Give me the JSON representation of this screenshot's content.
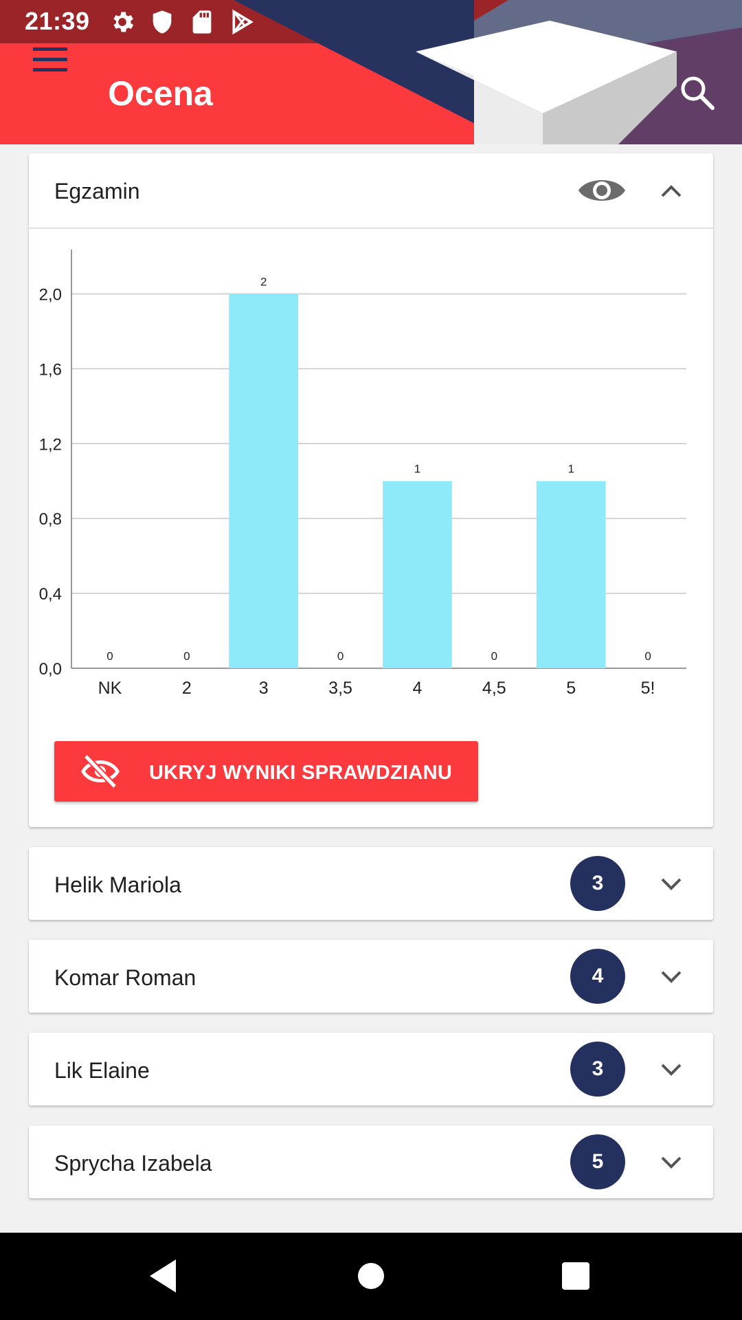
{
  "status_bar": {
    "time": "21:39",
    "left_icons": [
      "gear-icon",
      "shield-icon",
      "sd-card-icon",
      "play-store-icon"
    ],
    "right_icons": [
      "wifi-icon",
      "signal-icon",
      "battery-icon"
    ]
  },
  "app_bar": {
    "title": "Ocena",
    "menu_icon": "menu-icon",
    "search_icon": "search-icon",
    "color": "#fc3a3e"
  },
  "exam_card": {
    "title": "Egzamin",
    "visibility_icon": "eye-icon",
    "collapse_icon": "chevron-up-icon",
    "hide_button_label": "UKRYJ WYNIKI SPRAWDZIANU",
    "hide_button_icon": "eye-off-icon"
  },
  "chart_data": {
    "type": "bar",
    "categories": [
      "NK",
      "2",
      "3",
      "3,5",
      "4",
      "4,5",
      "5",
      "5!"
    ],
    "values": [
      0,
      0,
      2,
      0,
      1,
      0,
      1,
      0
    ],
    "value_labels": [
      "0",
      "0",
      "2",
      "0",
      "1",
      "0",
      "1",
      "0"
    ],
    "y_ticks": [
      "0,0",
      "0,4",
      "0,8",
      "1,2",
      "1,6",
      "2,0"
    ],
    "y_tick_values": [
      0,
      0.4,
      0.8,
      1.2,
      1.6,
      2.0
    ],
    "ylim": [
      0,
      2.2
    ],
    "grid": true,
    "bar_color": "#8ee9fb"
  },
  "students": [
    {
      "name": "Helik Mariola",
      "grade": "3"
    },
    {
      "name": "Komar Roman",
      "grade": "4"
    },
    {
      "name": "Lik Elaine",
      "grade": "3"
    },
    {
      "name": "Sprycha Izabela",
      "grade": "5"
    }
  ],
  "colors": {
    "primary": "#fc3a3e",
    "status_bar": "#9b2428",
    "badge": "#24305e"
  },
  "nav_bar": {
    "back_icon": "back-icon",
    "home_icon": "home-icon",
    "recents_icon": "recents-icon"
  }
}
